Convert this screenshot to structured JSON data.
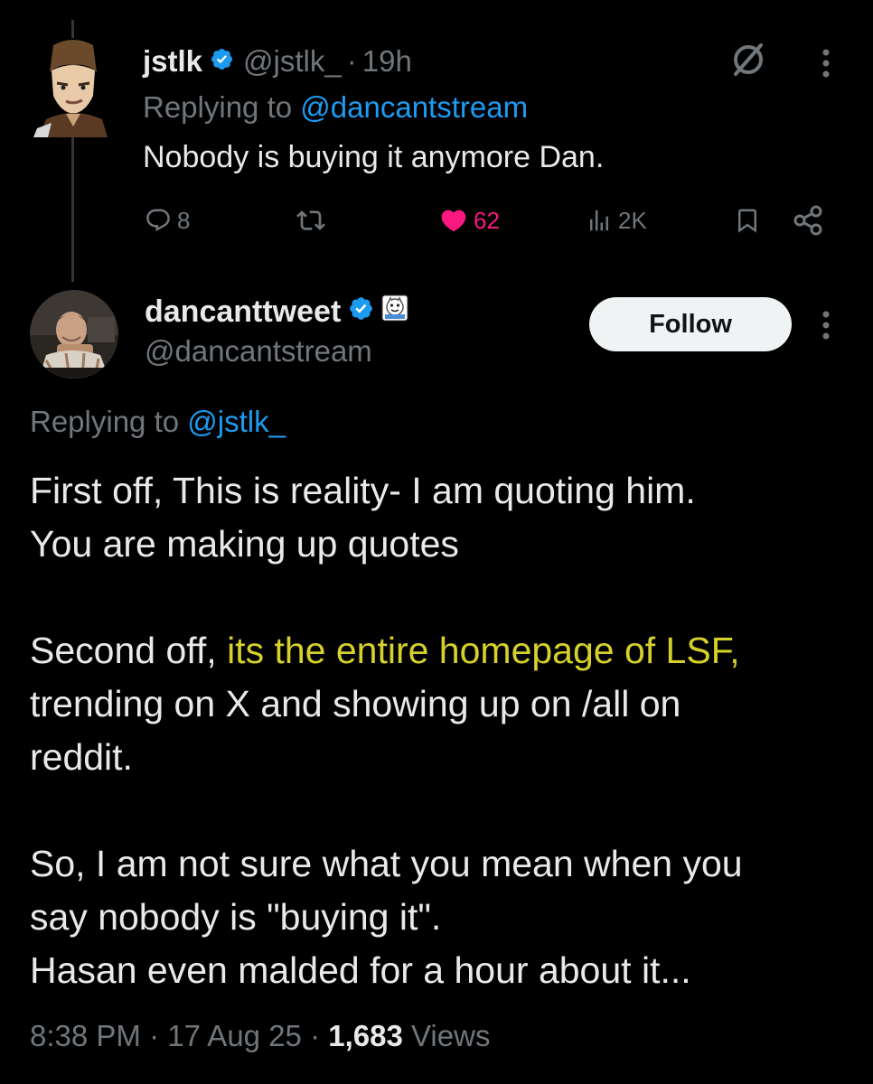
{
  "colors": {
    "background": "#000000",
    "text_primary": "#e7e9ea",
    "text_secondary": "#71767b",
    "link": "#1d9bf0",
    "like": "#f91880",
    "verified": "#1d9bf0",
    "highlight": "#d6d02b",
    "follow_bg": "#eff3f4"
  },
  "reply_tweet": {
    "display_name": "jstlk",
    "handle": "@jstlk_",
    "separator": "·",
    "time": "19h",
    "replying_prefix": "Replying to",
    "replying_to": "@dancantstream",
    "text": "Nobody is buying it anymore Dan.",
    "icons": {
      "verified": "verified-badge-icon",
      "grok": "grok-icon",
      "more": "more-vertical-icon"
    },
    "actions": {
      "replies": "8",
      "reposts": "",
      "likes": "62",
      "views": "2K"
    }
  },
  "main_tweet": {
    "display_name": "dancanttweet",
    "handle": "@dancantstream",
    "follow_label": "Follow",
    "replying_prefix": "Replying to",
    "replying_to": "@jstlk_",
    "paragraphs": [
      {
        "lines": [
          "First off, This is reality- I am quoting him.",
          "You are making up quotes"
        ]
      },
      {
        "line1_prefix": "Second off, ",
        "line1_highlight": "its the entire homepage of LSF,",
        "lines_rest": [
          "trending on X and showing up on /all on",
          "reddit."
        ]
      },
      {
        "lines": [
          "So, I am not sure what you mean when you",
          "say nobody is \"buying it\".",
          "Hasan even malded for a hour about it..."
        ]
      }
    ],
    "time": "8:38 PM",
    "date": "17 Aug 25",
    "separator": "·",
    "views_count": "1,683",
    "views_label": "Views",
    "icons": {
      "verified": "verified-badge-icon",
      "affiliate": "affiliate-badge-icon",
      "more": "more-vertical-icon"
    }
  }
}
